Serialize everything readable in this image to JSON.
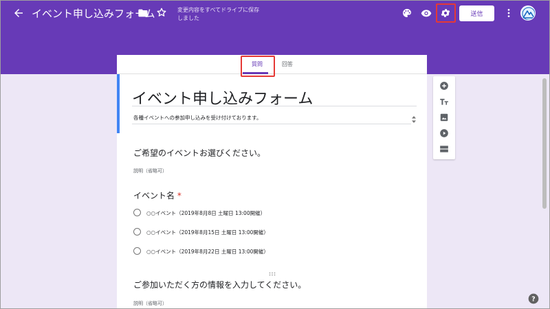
{
  "header": {
    "title": "イベント申し込みフォーム",
    "save_status": "変更内容をすべてドライブに保存しました",
    "send_label": "送信"
  },
  "tabs": [
    {
      "label": "質問",
      "active": true
    },
    {
      "label": "回答",
      "active": false
    }
  ],
  "form": {
    "title": "イベント申し込みフォーム",
    "description": "各種イベントへの参加申し込みを受け付けております。",
    "sections": [
      {
        "title": "ご希望のイベントお選びください。",
        "description": "説明（省略可）"
      },
      {
        "title": "ご参加いただく方の情報を入力してください。",
        "description": "説明（省略可）"
      }
    ],
    "question": {
      "title": "イベント名",
      "required_mark": "*",
      "options": [
        "○○イベント（2019年8月8日 土曜日 13:00開催）",
        "○○イベント（2019年8月15日 土曜日 13:00開催）",
        "○○イベント（2019年8月22日 土曜日 13:00開催）"
      ]
    }
  },
  "tools": [
    "add-question-icon",
    "add-title-icon",
    "add-image-icon",
    "add-video-icon",
    "add-section-icon"
  ],
  "colors": {
    "accent": "#673ab7",
    "background": "#ede7f6",
    "highlight": "#e53935",
    "focus": "#4285f4"
  }
}
